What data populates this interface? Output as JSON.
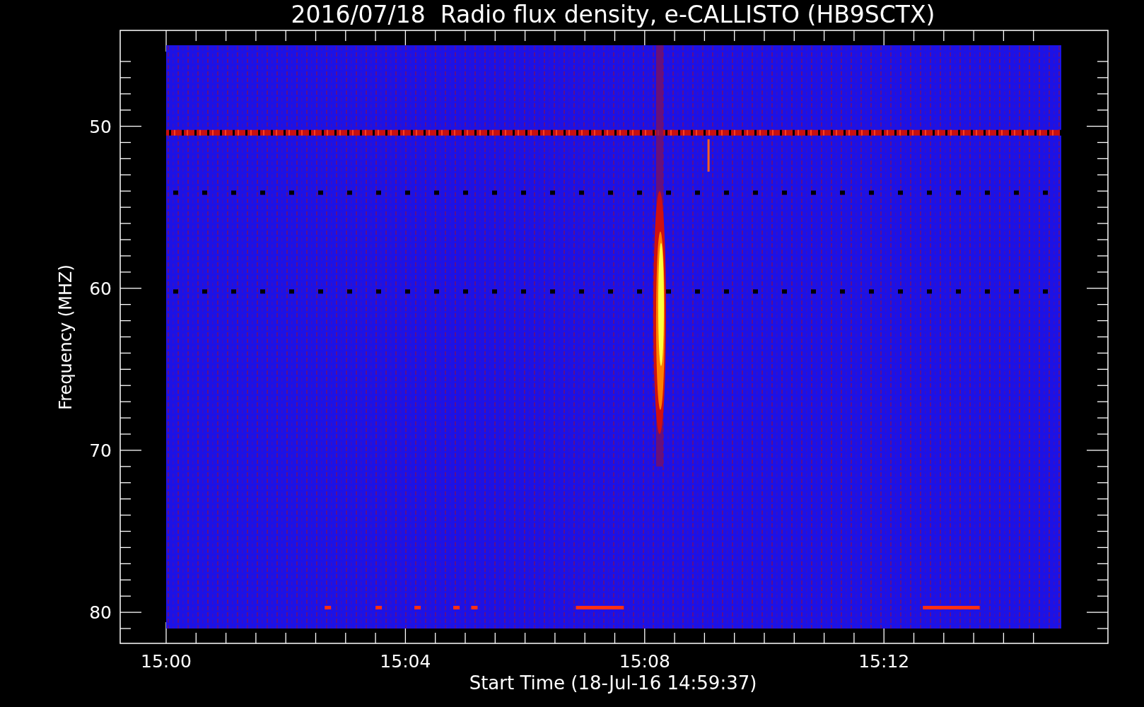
{
  "title": "2016/07/18  Radio flux density, e-CALLISTO (HB9SCTX)",
  "ylabel": "Frequency (MHZ)",
  "xlabel": "Start Time (18-Jul-16 14:59:37)",
  "yticks": [
    "50",
    "60",
    "70",
    "80"
  ],
  "xticks": [
    "15:00",
    "15:04",
    "15:08",
    "15:12"
  ]
}
